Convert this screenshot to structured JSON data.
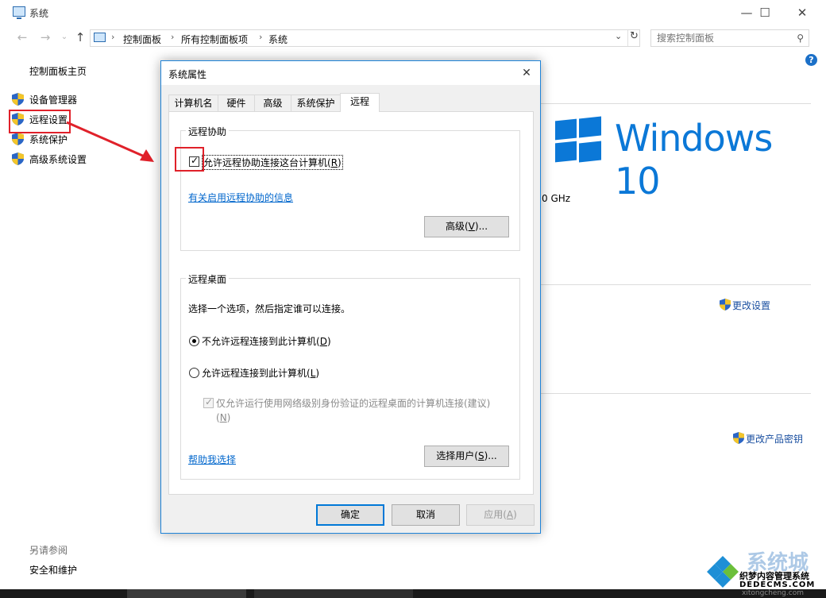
{
  "window": {
    "title": "系统",
    "minimize": "—",
    "maximize": "☐",
    "close": "✕"
  },
  "nav": {
    "back": "←",
    "forward": "→",
    "dropdown": "⌄",
    "up": "↑"
  },
  "address": {
    "crumbs": [
      "控制面板",
      "所有控制面板项",
      "系统"
    ],
    "separator": "›",
    "dropdown": "⌄",
    "refresh": "↻"
  },
  "search": {
    "placeholder": "搜索控制面板",
    "icon": "⚲"
  },
  "help": "?",
  "left": {
    "home": "控制面板主页",
    "items": [
      {
        "label": "设备管理器"
      },
      {
        "label": "远程设置"
      },
      {
        "label": "系统保护"
      },
      {
        "label": "高级系统设置"
      }
    ],
    "see_also": "另请参阅",
    "see_also_item": "安全和维护"
  },
  "right": {
    "windows_text": "Windows 10",
    "cpu_fragment": "0 GHz",
    "change_settings": "更改设置",
    "change_product_key": "更改产品密钥"
  },
  "dialog": {
    "title": "系统属性",
    "close": "✕",
    "tabs": [
      "计算机名",
      "硬件",
      "高级",
      "系统保护",
      "远程"
    ],
    "active_tab": "远程",
    "remote_assistance": {
      "group_label": "远程协助",
      "allow_checkbox": {
        "label": "允许远程协助连接这台计算机",
        "key": "R",
        "checked": true
      },
      "info_link": "有关启用远程协助的信息",
      "advanced_button": {
        "label": "高级",
        "key": "V",
        "suffix": "..."
      }
    },
    "remote_desktop": {
      "group_label": "远程桌面",
      "instruction": "选择一个选项，然后指定谁可以连接。",
      "option_deny": {
        "label": "不允许远程连接到此计算机",
        "key": "D",
        "selected": true
      },
      "option_allow": {
        "label": "允许远程连接到此计算机",
        "key": "L",
        "selected": false
      },
      "nla_checkbox": {
        "label": "仅允许运行使用网络级别身份验证的远程桌面的计算机连接(建议)",
        "key": "N",
        "checked": true,
        "enabled": false
      },
      "help_link": "帮助我选择",
      "select_users_button": {
        "label": "选择用户",
        "key": "S",
        "suffix": "..."
      }
    },
    "buttons": {
      "ok": "确定",
      "cancel": "取消",
      "apply": "应用",
      "apply_key": "A"
    }
  },
  "watermark": {
    "line1": "织梦内容管理系统",
    "line2": "DEDECMS.COM",
    "big": "系统城",
    "url": "xitongcheng.com"
  },
  "colors": {
    "accent": "#0078d7",
    "windows_blue": "#0b78d7",
    "annotation_red": "#e0212a",
    "link": "#0066cc"
  }
}
